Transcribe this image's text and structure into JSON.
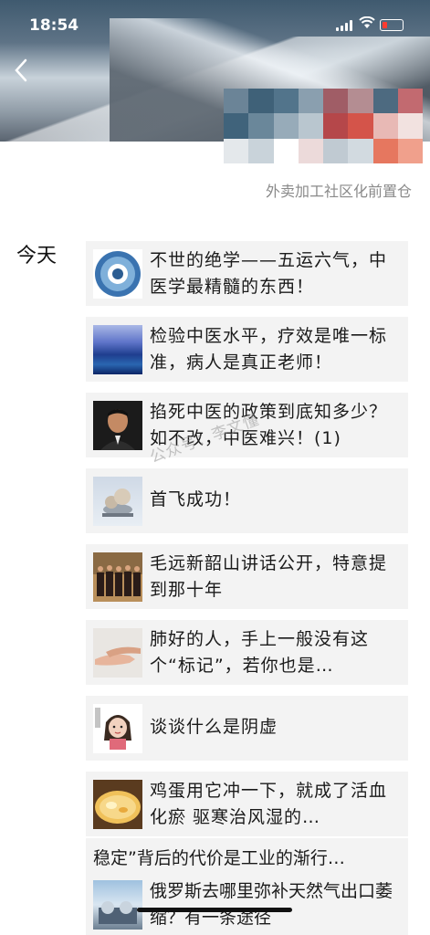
{
  "status_bar": {
    "time": "18:54"
  },
  "header": {
    "back_icon": "chevron-left-icon",
    "tagline": "外卖加工社区化前置仓"
  },
  "section": {
    "day_label": "今天"
  },
  "articles": [
    {
      "title": "不世的绝学——五运六气，中医学最精髓的东西！",
      "thumb": "yunqi-wheel"
    },
    {
      "title": "检验中医水平，疗效是唯一标准，病人是真正老师！",
      "thumb": "ocean-wave"
    },
    {
      "title": "掐死中医的政策到底知多少？如不改，中医难兴！(1)",
      "thumb": "portrait"
    },
    {
      "title": "首飞成功！",
      "thumb": "drone"
    },
    {
      "title": "毛远新韶山讲话公开，特意提到那十年",
      "thumb": "group-photo"
    },
    {
      "title": "肺好的人，手上一般没有这个“标记”，若你也是…",
      "thumb": "hands"
    },
    {
      "title": "谈谈什么是阴虚",
      "thumb": "cartoon-girl"
    },
    {
      "title": "鸡蛋用它冲一下，就成了活血化瘀 驱寒治风湿的…",
      "thumb": "egg-dish"
    }
  ],
  "last_card": {
    "top_line": "稳定”背后的代价是工业的渐行…",
    "title": "俄罗斯去哪里弥补天然气出口萎缩？有一条途径",
    "thumb": "gas-facility"
  },
  "watermark": "公众号：李文懂",
  "colors": {
    "battery_low": "#ff3b30",
    "card_bg": "#f3f3f3",
    "tagline": "#8a8a8a"
  }
}
